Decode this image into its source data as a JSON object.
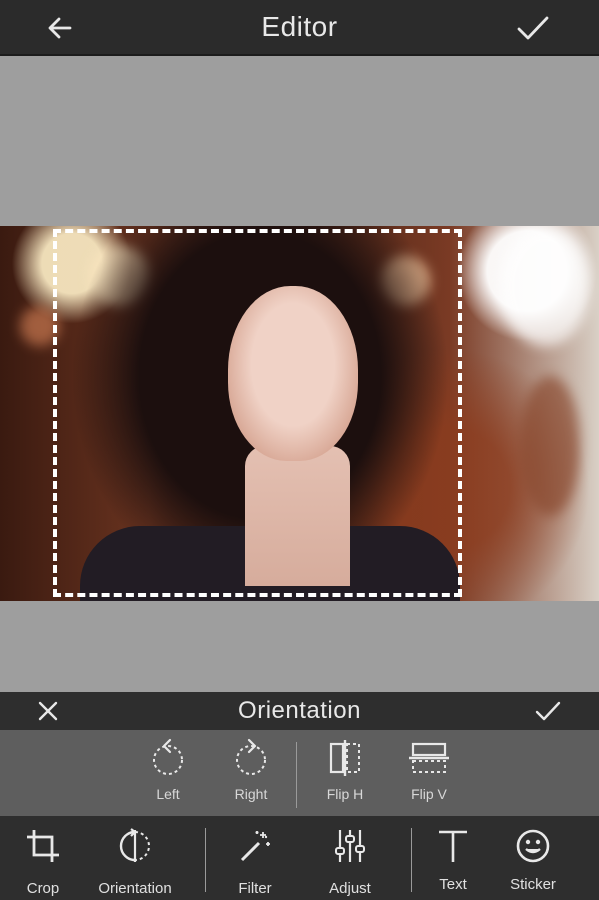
{
  "header": {
    "title": "Editor",
    "back_icon": "arrow-left-icon",
    "done_icon": "check-icon"
  },
  "orientation_panel": {
    "title": "Orientation",
    "cancel_icon": "close-icon",
    "apply_icon": "check-icon",
    "tools": [
      {
        "label": "Left",
        "icon": "rotate-left-icon"
      },
      {
        "label": "Right",
        "icon": "rotate-right-icon"
      },
      {
        "label": "Flip H",
        "icon": "flip-horizontal-icon"
      },
      {
        "label": "Flip V",
        "icon": "flip-vertical-icon"
      }
    ]
  },
  "toolbar": {
    "items": [
      {
        "label": "Crop",
        "icon": "crop-icon"
      },
      {
        "label": "Orientation",
        "icon": "orientation-icon"
      },
      {
        "label": "Filter",
        "icon": "magic-wand-icon"
      },
      {
        "label": "Adjust",
        "icon": "sliders-icon"
      },
      {
        "label": "Text",
        "icon": "text-icon"
      },
      {
        "label": "Sticker",
        "icon": "smiley-icon"
      }
    ]
  },
  "colors": {
    "bar_dark": "#2b2b2b",
    "canvas_gray": "#9e9e9e",
    "tools_gray": "#5e5e5e",
    "icon_light": "#e8e8e8"
  }
}
